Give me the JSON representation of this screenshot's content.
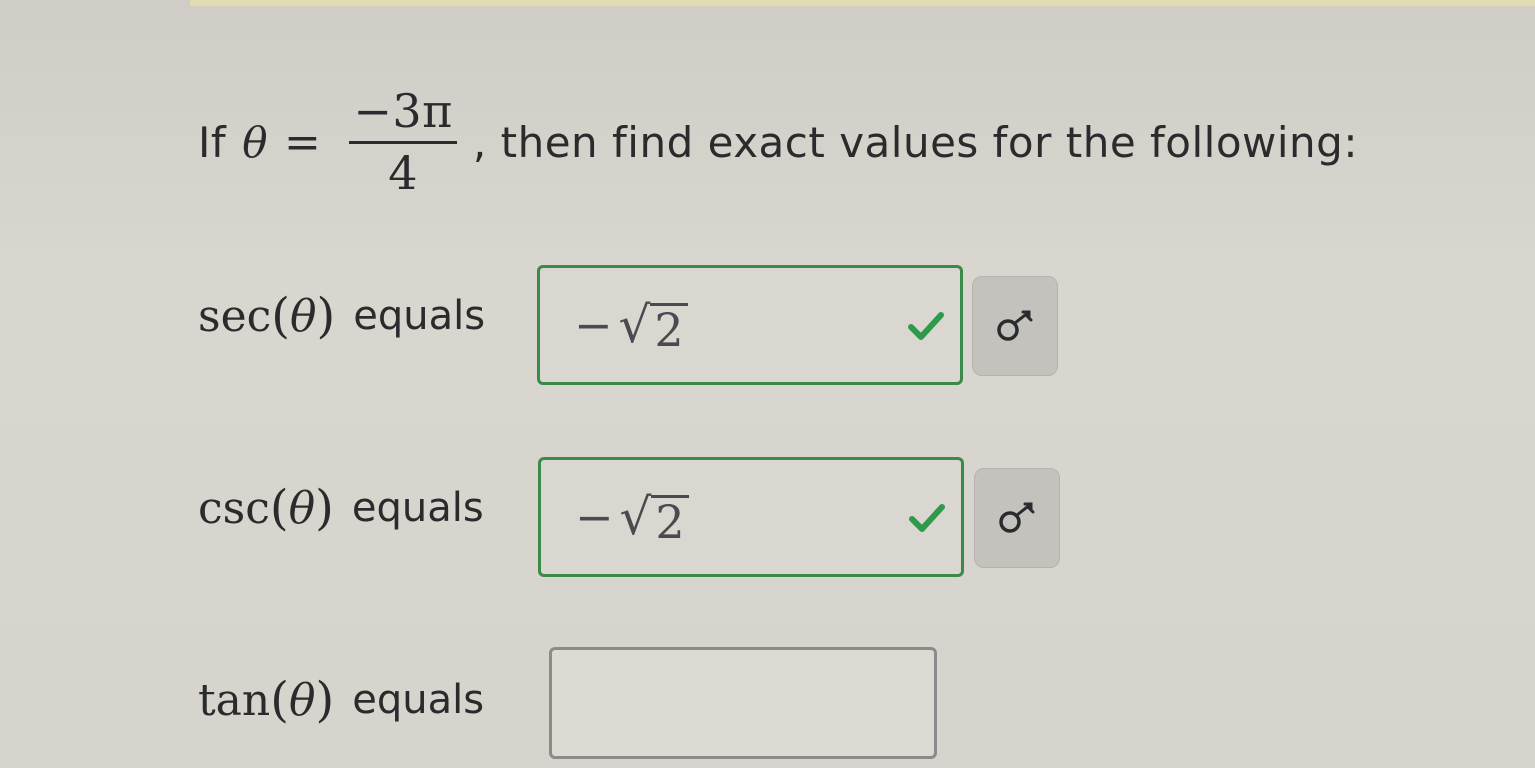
{
  "question": {
    "prefix": "If",
    "variable": "θ",
    "equals": "=",
    "numerator": "−3π",
    "denominator": "4",
    "suffix": ", then find exact values for the following:"
  },
  "rows": [
    {
      "function": "sec",
      "open_paren": "(",
      "variable": "θ",
      "close_paren": ")",
      "equals_word": "equals",
      "answer_sign": "−",
      "answer_root_symbol": "√",
      "answer_radicand": "2",
      "status": "correct",
      "status_icon": "check-icon",
      "key_icon": "key-icon"
    },
    {
      "function": "csc",
      "open_paren": "(",
      "variable": "θ",
      "close_paren": ")",
      "equals_word": "equals",
      "answer_sign": "−",
      "answer_root_symbol": "√",
      "answer_radicand": "2",
      "status": "correct",
      "status_icon": "check-icon",
      "key_icon": "key-icon"
    },
    {
      "function": "tan",
      "open_paren": "(",
      "variable": "θ",
      "close_paren": ")",
      "equals_word": "equals",
      "answer_value": "",
      "status": "unanswered"
    }
  ],
  "colors": {
    "correct_border": "#3a8a4a",
    "check_mark": "#2f9a4c",
    "empty_border": "#8b8b8b",
    "background": "#d6d4cc"
  }
}
